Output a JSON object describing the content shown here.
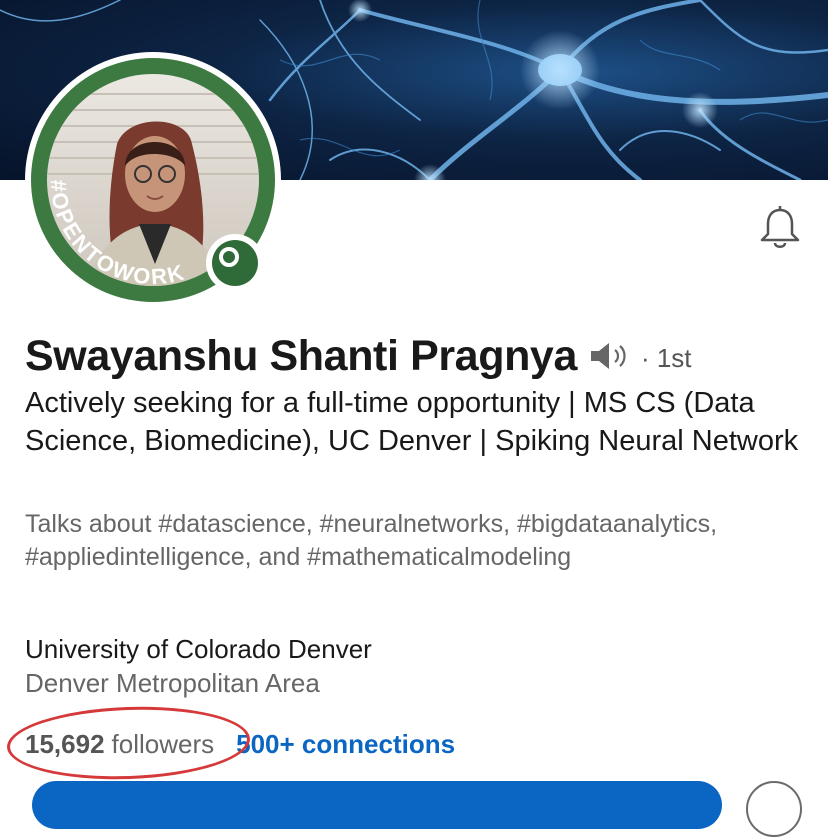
{
  "profile": {
    "name": "Swayanshu Shanti Pragnya",
    "degree": "· 1st",
    "headline": "Actively seeking for a full-time opportunity | MS CS (Data Science, Biomedicine), UC Denver | Spiking Neural Network",
    "talks_about": "Talks about #datascience, #neuralnetworks, #bigdataanalytics, #appliedintelligence, and #mathematicalmodeling",
    "school": "University of Colorado Denver",
    "location": "Denver Metropolitan Area",
    "open_to_work_frame": "#OPENTOWORK"
  },
  "stats": {
    "followers_count": "15,692",
    "followers_label": "followers",
    "connections": "500+ connections"
  },
  "icons": {
    "bell": "bell-icon",
    "speaker": "speaker-icon",
    "open_to_work": "open-to-work-icon"
  },
  "colors": {
    "link_blue": "#0a66c2",
    "open_to_work_green": "#3d7a42",
    "annotation_red": "#d5393a",
    "banner_dark": "#06132a"
  }
}
